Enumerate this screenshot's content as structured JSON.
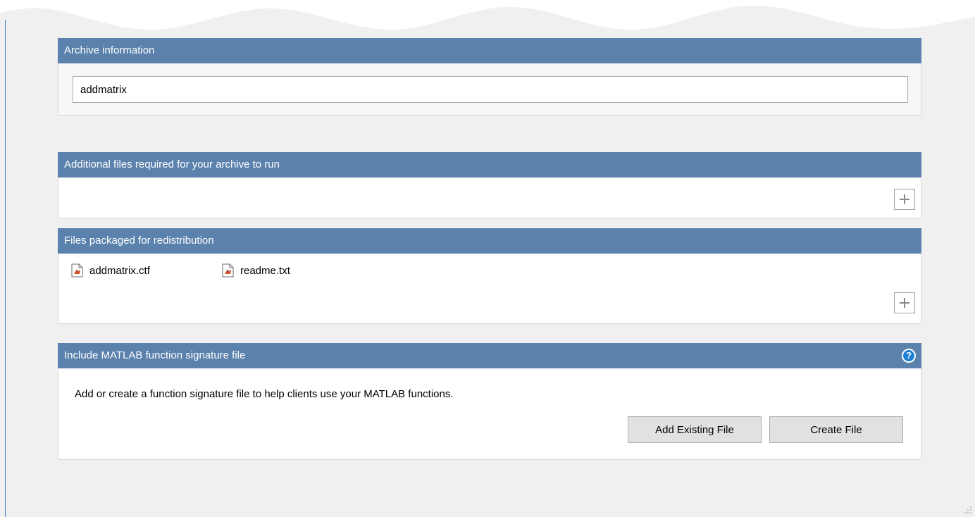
{
  "archive_panel": {
    "title": "Archive information",
    "name_value": "addmatrix"
  },
  "additional_panel": {
    "title": "Additional files required for your archive to run",
    "add_icon": "plus-icon"
  },
  "redist_panel": {
    "title": "Files packaged for redistribution",
    "files": [
      {
        "name": "addmatrix.ctf",
        "icon": "file-icon"
      },
      {
        "name": "readme.txt",
        "icon": "file-icon"
      }
    ],
    "add_icon": "plus-icon"
  },
  "signature_panel": {
    "title": "Include MATLAB function signature file",
    "help_label": "?",
    "description": "Add or create a function signature file to help clients use your MATLAB functions.",
    "add_existing_label": "Add Existing File",
    "create_label": "Create File"
  },
  "colors": {
    "header_bg": "#5b81ad",
    "page_bg": "#f0f0f0",
    "accent_border": "#3d7ebf",
    "help_icon": "#1e7fd4"
  }
}
